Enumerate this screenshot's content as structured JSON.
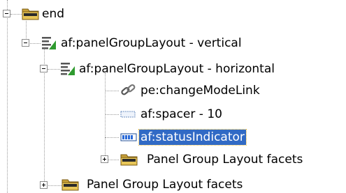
{
  "tree": {
    "nodes": [
      {
        "label": "end",
        "icon": "folder-icon",
        "expanded": true
      },
      {
        "label": "af:panelGroupLayout - vertical",
        "icon": "panel-group-layout-icon",
        "expanded": true
      },
      {
        "label": "af:panelGroupLayout - horizontal",
        "icon": "panel-group-layout-icon",
        "expanded": true
      },
      {
        "label": "pe:changeModeLink",
        "icon": "link-icon"
      },
      {
        "label": "af:spacer - 10",
        "icon": "spacer-icon"
      },
      {
        "label": "af:statusIndicator",
        "icon": "status-indicator-icon",
        "selected": true
      },
      {
        "label": "Panel Group Layout facets",
        "icon": "folder-icon",
        "expanded": false
      },
      {
        "label": "Panel Group Layout facets",
        "icon": "folder-icon",
        "expanded": false
      }
    ]
  }
}
